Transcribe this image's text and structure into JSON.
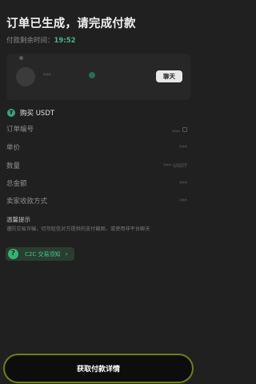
{
  "header": {
    "title": "订单已生成，请完成付款",
    "timer_label": "付款剩余时间：",
    "timer_value": "19:52"
  },
  "merchant": {
    "name": "***",
    "chat_label": "聊天"
  },
  "order": {
    "buy_label": "购买 USDT",
    "rows": [
      {
        "label": "订单编号",
        "value": "***"
      },
      {
        "label": "单价",
        "value": "***"
      },
      {
        "label": "数量",
        "value": "*** USDT"
      },
      {
        "label": "总金额",
        "value": "***"
      },
      {
        "label": "卖家收款方式",
        "value": "***"
      }
    ]
  },
  "tips": {
    "title": "温馨提示",
    "text": "谨防交易诈骗，切勿轻信对方提供的支付截图，或使用非平台聊天"
  },
  "c2c": {
    "icon_glyph": "?",
    "label": "C2C 交易须知",
    "chevron": "›"
  },
  "footer": {
    "cta_label": "获取付款详情"
  }
}
